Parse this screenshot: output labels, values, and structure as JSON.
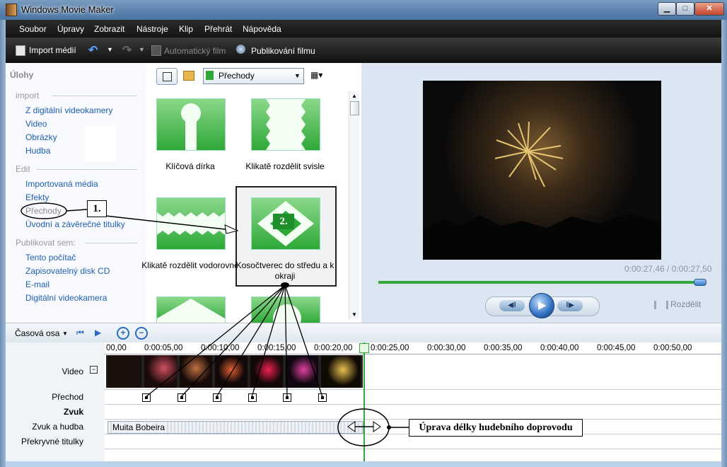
{
  "window": {
    "title": "Windows Movie Maker"
  },
  "menu": [
    {
      "label": "Soubor"
    },
    {
      "label": "Úpravy"
    },
    {
      "label": "Zobrazit"
    },
    {
      "label": "Nástroje"
    },
    {
      "label": "Klip"
    },
    {
      "label": "Přehrát"
    },
    {
      "label": "Nápověda"
    }
  ],
  "toolbar": {
    "import_label": "Import médií",
    "auto_label": "Automatický film",
    "publish_label": "Publikování filmu"
  },
  "tasks": {
    "title": "Úlohy",
    "import_header": "import",
    "import_items": [
      "Z digitální videokamery",
      "Video",
      "Obrázky",
      "Hudba"
    ],
    "edit_header": "Edit",
    "edit_items": [
      "Importovaná média",
      "Efekty",
      "Přechody",
      "Úvodní a závěrečné titulky"
    ],
    "publish_header": "Publikovat sem:",
    "publish_items": [
      "Tento počítač",
      "Zapisovatelný disk CD",
      "E-mail",
      "Digitální videokamera"
    ]
  },
  "content": {
    "dropdown_value": "Přechody",
    "tiles": [
      {
        "label": "Klíčová dírka",
        "icon": "keyhole-icon"
      },
      {
        "label": "Klikatě rozdělit svisle",
        "icon": "zigzag-vertical-icon"
      },
      {
        "label": "Klikatě rozdělit vodorovně",
        "icon": "zigzag-horizontal-icon"
      },
      {
        "label": "Kosočtverec do středu a k okraji",
        "icon": "diamond-icon"
      }
    ]
  },
  "preview": {
    "time": "0:00:27,46 / 0:00:27,50",
    "progress": 0.999,
    "split_label": "Rozdělit"
  },
  "timeline": {
    "view_label": "Časová osa",
    "ruler": [
      "00,00",
      "0:00:05,00",
      "0:00:10,00",
      "0:00:15,00",
      "0:00:20,00",
      "0:00:25,00",
      "0:00:30,00",
      "0:00:35,00",
      "0:00:40,00",
      "0:00:45,00",
      "0:00:50,00"
    ],
    "tracks": [
      "Video",
      "Přechod",
      "Zvuk",
      "Zvuk a hudba",
      "Překryvné titulky"
    ],
    "audio_clip": "Muita Bobeira"
  },
  "annotations": {
    "callout1": "1.",
    "callout2": "2.",
    "music_note": "Úprava délky hudebního doprovodu"
  },
  "colors": {
    "accent_green": "#2fa838",
    "link_blue": "#1f5fb0"
  }
}
